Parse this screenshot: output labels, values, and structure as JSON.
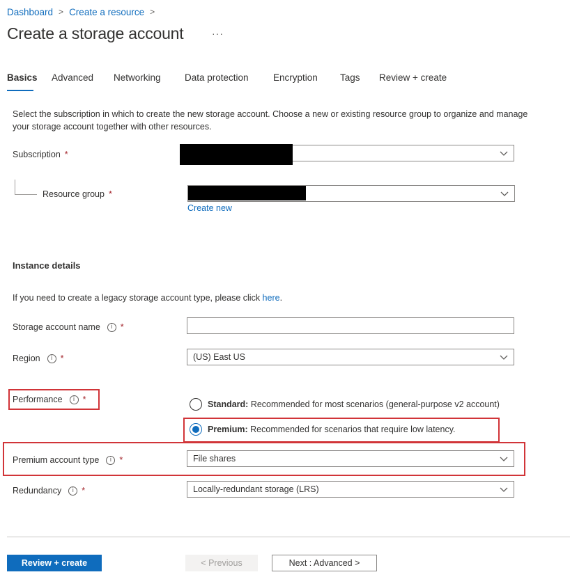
{
  "breadcrumb": {
    "items": [
      "Dashboard",
      "Create a resource"
    ],
    "separator": ">"
  },
  "page": {
    "title": "Create a storage account",
    "more": "···"
  },
  "tabs": [
    "Basics",
    "Advanced",
    "Networking",
    "Data protection",
    "Encryption",
    "Tags",
    "Review + create"
  ],
  "active_tab": "Basics",
  "basics": {
    "description": "Select the subscription in which to create the new storage account. Choose a new or existing resource group to organize and manage your storage account together with other resources.",
    "subscription": {
      "label": "Subscription",
      "required": "*",
      "value": ""
    },
    "resource_group": {
      "label": "Resource group",
      "required": "*",
      "value": "",
      "create_new": "Create new"
    }
  },
  "instance": {
    "title": "Instance details",
    "legacy_text": "If you need to create a legacy storage account type, please click ",
    "legacy_link": "here",
    "legacy_period": ".",
    "name": {
      "label": "Storage account name",
      "required": "*",
      "value": ""
    },
    "region": {
      "label": "Region",
      "required": "*",
      "value": "(US) East US"
    },
    "performance": {
      "label": "Performance",
      "required": "*",
      "options": [
        {
          "name": "Standard:",
          "desc": "Recommended for most scenarios (general-purpose v2 account)",
          "selected": false
        },
        {
          "name": "Premium:",
          "desc": "Recommended for scenarios that require low latency.",
          "selected": true
        }
      ]
    },
    "premium_type": {
      "label": "Premium account type",
      "required": "*",
      "value": "File shares"
    },
    "redundancy": {
      "label": "Redundancy",
      "required": "*",
      "value": "Locally-redundant storage (LRS)"
    }
  },
  "footer": {
    "review_create": "Review + create",
    "previous": "< Previous",
    "next": "Next : Advanced >"
  },
  "icons": {
    "info": "info-icon",
    "chevron": "chevron-down-icon",
    "more": "more-icon"
  },
  "colors": {
    "accent": "#0f6cbd",
    "highlight": "#d13438",
    "required": "#a4262c"
  }
}
